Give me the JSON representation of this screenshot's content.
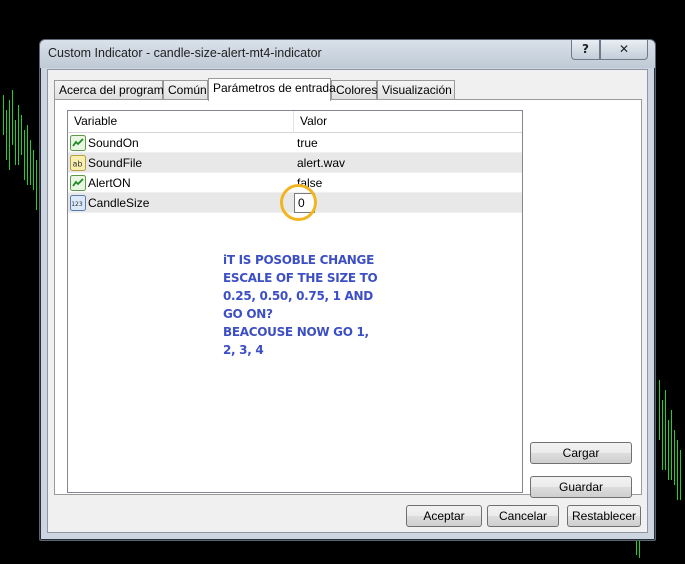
{
  "window": {
    "title": "Custom Indicator - candle-size-alert-mt4-indicator",
    "help_button": "?",
    "close_button": "✕"
  },
  "tabs": [
    {
      "label": "Acerca del programa",
      "active": false
    },
    {
      "label": "Común",
      "active": false
    },
    {
      "label": "Parámetros de entrada",
      "active": true
    },
    {
      "label": "Colores",
      "active": false
    },
    {
      "label": "Visualización",
      "active": false
    }
  ],
  "grid": {
    "columns": [
      "Variable",
      "Valor"
    ],
    "rows": [
      {
        "icon": "bool-icon",
        "variable": "SoundOn",
        "value": "true"
      },
      {
        "icon": "string-icon",
        "variable": "SoundFile",
        "value": "alert.wav"
      },
      {
        "icon": "bool-icon",
        "variable": "AlertON",
        "value": "false"
      },
      {
        "icon": "number-icon",
        "variable": "CandleSize",
        "value": "0"
      }
    ]
  },
  "annotation": {
    "lines": [
      "iT IS POSOBLE CHANGE",
      "ESCALE OF THE SIZE TO",
      "0.25, 0.50, 0.75, 1 AND",
      "GO ON?",
      "BEACOUSE NOW GO 1,",
      "2, 3, 4"
    ],
    "text_color": "#3d4fc4",
    "ring_color": "#f2b520"
  },
  "side_buttons": {
    "load": "Cargar",
    "save": "Guardar"
  },
  "footer_buttons": {
    "accept": "Aceptar",
    "cancel": "Cancelar",
    "reset": "Restablecer"
  },
  "colors": {
    "chart_bars": "#1fd12a",
    "background": "#000000"
  }
}
